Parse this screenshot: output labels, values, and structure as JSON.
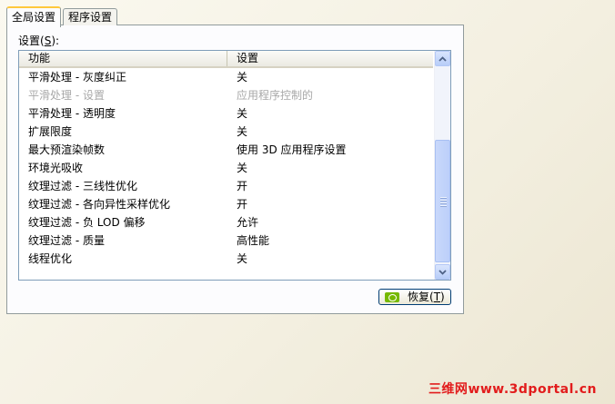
{
  "tabs": [
    {
      "label": "全局设置",
      "active": true
    },
    {
      "label": "程序设置",
      "active": false
    }
  ],
  "settings_label": {
    "text": "设置",
    "mnemonic": "S",
    "open": "(",
    "close": "):"
  },
  "list": {
    "columns": [
      "功能",
      "设置"
    ],
    "rows": [
      {
        "feature": "平滑处理 - 灰度纠正",
        "setting": "关",
        "disabled": false
      },
      {
        "feature": "平滑处理 - 设置",
        "setting": "应用程序控制的",
        "disabled": true
      },
      {
        "feature": "平滑处理 - 透明度",
        "setting": "关",
        "disabled": false
      },
      {
        "feature": "扩展限度",
        "setting": "关",
        "disabled": false
      },
      {
        "feature": "最大预渲染帧数",
        "setting": "使用 3D 应用程序设置",
        "disabled": false
      },
      {
        "feature": "环境光吸收",
        "setting": "关",
        "disabled": false
      },
      {
        "feature": "纹理过滤 - 三线性优化",
        "setting": "开",
        "disabled": false
      },
      {
        "feature": "纹理过滤 - 各向异性采样优化",
        "setting": "开",
        "disabled": false
      },
      {
        "feature": "纹理过滤 - 负 LOD 偏移",
        "setting": "允许",
        "disabled": false
      },
      {
        "feature": "纹理过滤 - 质量",
        "setting": "高性能",
        "disabled": false
      },
      {
        "feature": "线程优化",
        "setting": "关",
        "disabled": false
      }
    ]
  },
  "restore_button": {
    "label": "恢复",
    "mnemonic": "T",
    "open": "(",
    "close": ")"
  },
  "watermark": {
    "cn": "三维网",
    "url": "www.3dportal.cn"
  },
  "colors": {
    "tab_accent": "#ffc83c",
    "disabled_text": "#a8a8a8",
    "watermark": "#e21c1c"
  },
  "icons": {
    "scroll_up": "chevron-up-icon",
    "scroll_down": "chevron-down-icon",
    "restore": "nvidia-logo-icon"
  }
}
